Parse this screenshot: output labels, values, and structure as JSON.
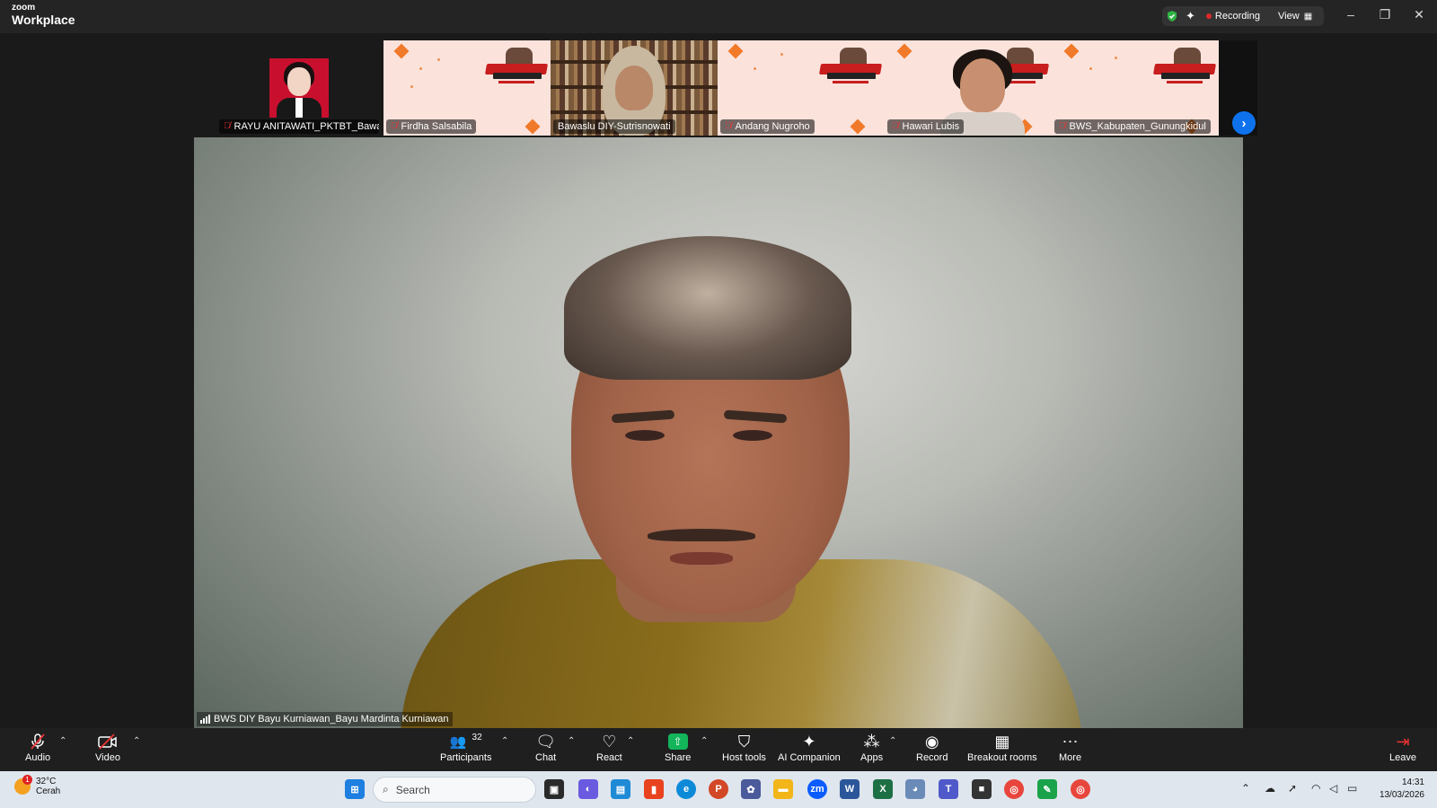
{
  "titlebar": {
    "logo_small": "zoom",
    "logo_big": "Workplace",
    "recording_label": "Recording",
    "view_label": "View",
    "icons": [
      "shield-check-icon",
      "ai-sparkle-icon",
      "grid-view-icon",
      "minimize-icon",
      "restore-icon",
      "close-icon"
    ]
  },
  "gallery": {
    "tiles": [
      {
        "name": "RAYU ANITAWATI_PKTBT_Bawaslu...",
        "muted": true
      },
      {
        "name": "Firdha Salsabila",
        "muted": true
      },
      {
        "name": "Bawaslu DIY-Sutrisnowati",
        "muted": false
      },
      {
        "name": "Andang Nugroho",
        "muted": true
      },
      {
        "name": "Hawari Lubis",
        "muted": true
      },
      {
        "name": "BWS_Kabupaten_Gunungkidul",
        "muted": true
      }
    ],
    "next_icon": "chevron-right-icon"
  },
  "speaker": {
    "name": "BWS DIY Bayu Kurniawan_Bayu Mardinta Kurniawan"
  },
  "toolbar": {
    "audio": "Audio",
    "video": "Video",
    "participants": "Participants",
    "participants_count": "32",
    "chat": "Chat",
    "react": "React",
    "share": "Share",
    "host_tools": "Host tools",
    "ai_companion": "AI Companion",
    "apps": "Apps",
    "record": "Record",
    "breakout": "Breakout rooms",
    "more": "More",
    "leave": "Leave"
  },
  "taskbar": {
    "weather_temp": "32°C",
    "weather_desc": "Cerah",
    "weather_badge": "1",
    "search_placeholder": "Search",
    "time": "14:31",
    "date": "13/03/2026"
  },
  "colors": {
    "accent": "#0e72ed",
    "share_green": "#12b55a",
    "muted_red": "#e33333"
  }
}
